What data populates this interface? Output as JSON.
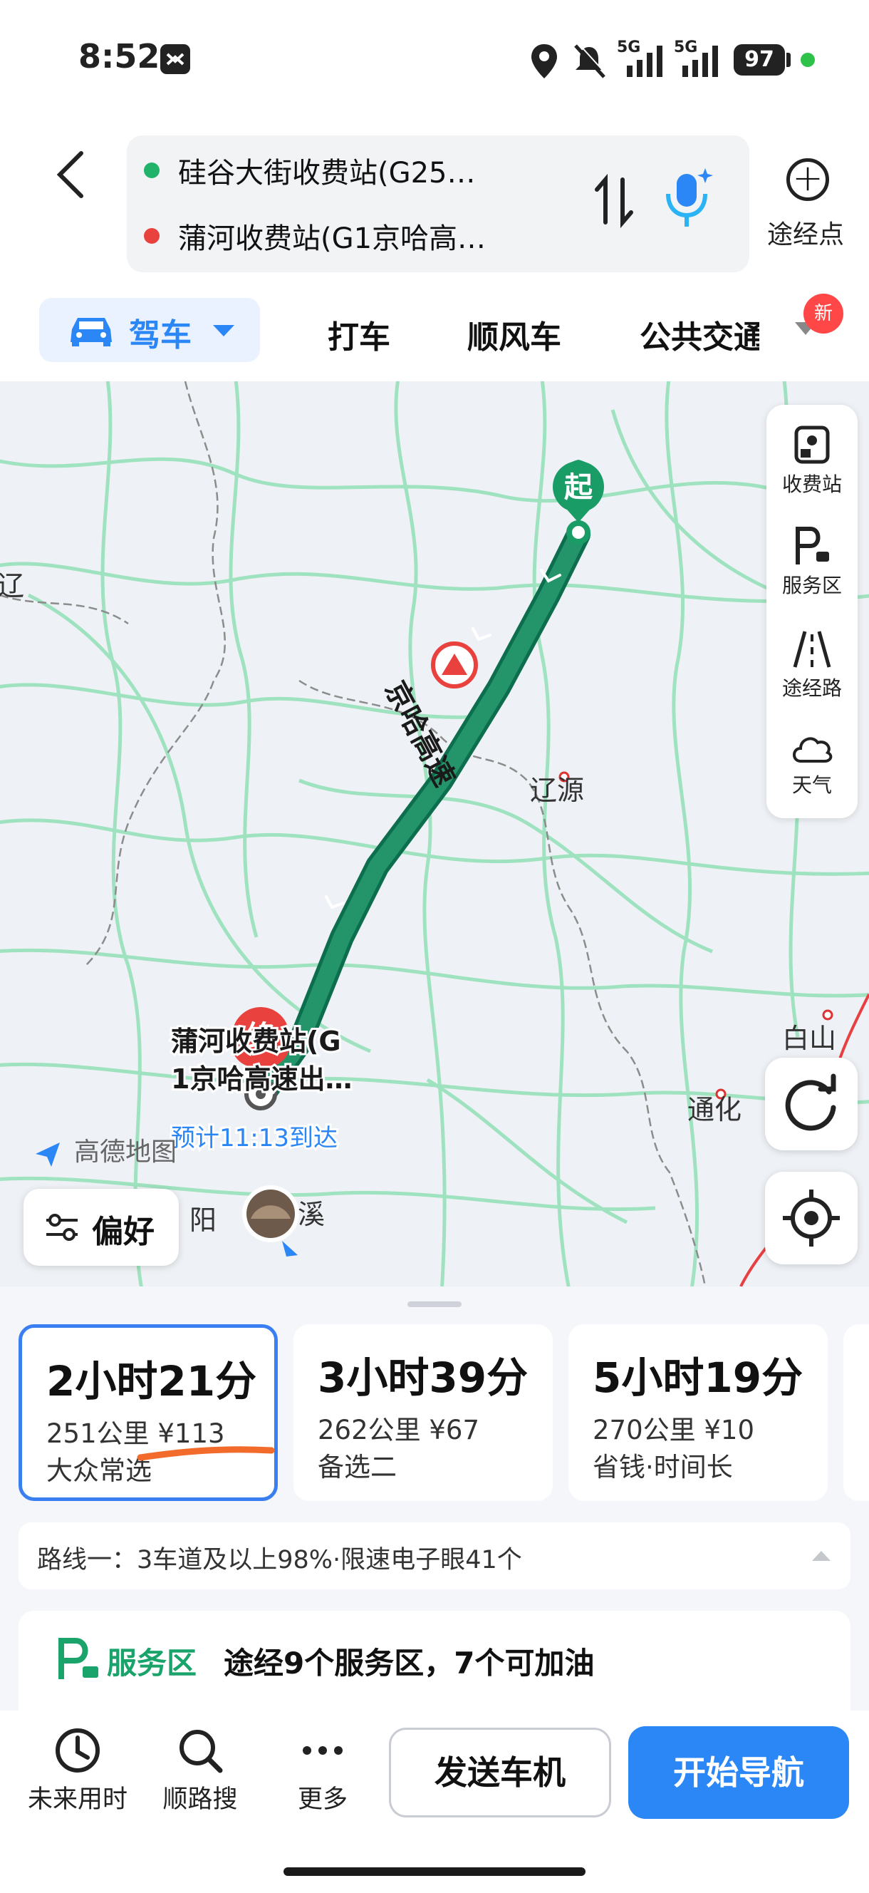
{
  "status_bar": {
    "time": "8:52",
    "battery": "97",
    "network1": "5G",
    "network2": "5G"
  },
  "route": {
    "origin": "硅谷大街收费站(G25…",
    "destination": "蒲河收费站(G1京哈高…",
    "via_label": "途经点"
  },
  "modes": {
    "drive": "驾车",
    "taxi": "打车",
    "carpool": "顺风车",
    "transit": "公共交通",
    "new_badge": "新"
  },
  "map_controls": {
    "toll": "收费站",
    "service": "服务区",
    "via_road": "途经路",
    "weather": "天气",
    "preference": "偏好"
  },
  "map_labels": {
    "start_marker": "起",
    "end_marker": "终",
    "highway_name": "京哈高速",
    "city1": "辽源",
    "city2": "白山",
    "city3": "通化",
    "city4": "辽",
    "city5": "阳",
    "city6": "溪",
    "end_name_line1": "蒲河收费站(G",
    "end_name_line2": "1京哈高速出…",
    "eta": "预计11:13到达",
    "brand": "高德地图"
  },
  "route_options": [
    {
      "time": "2小时21分",
      "detail": "251公里 ¥113",
      "note": "大众常选"
    },
    {
      "time": "3小时39分",
      "detail": "262公里 ¥67",
      "note": "备选二"
    },
    {
      "time": "5小时19分",
      "detail": "270公里 ¥10",
      "note": "省钱·时间长"
    }
  ],
  "route_info": "路线一：3车道及以上98%·限速电子眼41个",
  "service_area": {
    "title": "服务区",
    "text": "途经9个服务区，7个可加油"
  },
  "bottom_tools": {
    "future": "未来用时",
    "search": "顺路搜",
    "more": "更多"
  },
  "actions": {
    "send": "发送车机",
    "navigate": "开始导航"
  },
  "colors": {
    "accent": "#2b86f6",
    "route": "#1e7f5c",
    "start": "#1aa36b",
    "end": "#e8413e"
  }
}
